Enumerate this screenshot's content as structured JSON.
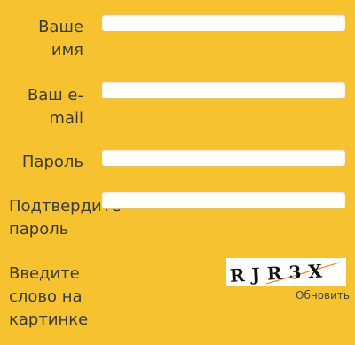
{
  "form": {
    "name_label": "Ваше\nимя",
    "email_label": "Ваш e-\nmail",
    "password_label": "Пароль",
    "confirm_label": "Подтвердите\nпароль",
    "captcha_label": "Введите\nслово на\nкартинке",
    "captcha_text": "RJR3X",
    "refresh_label": "Обновить"
  }
}
